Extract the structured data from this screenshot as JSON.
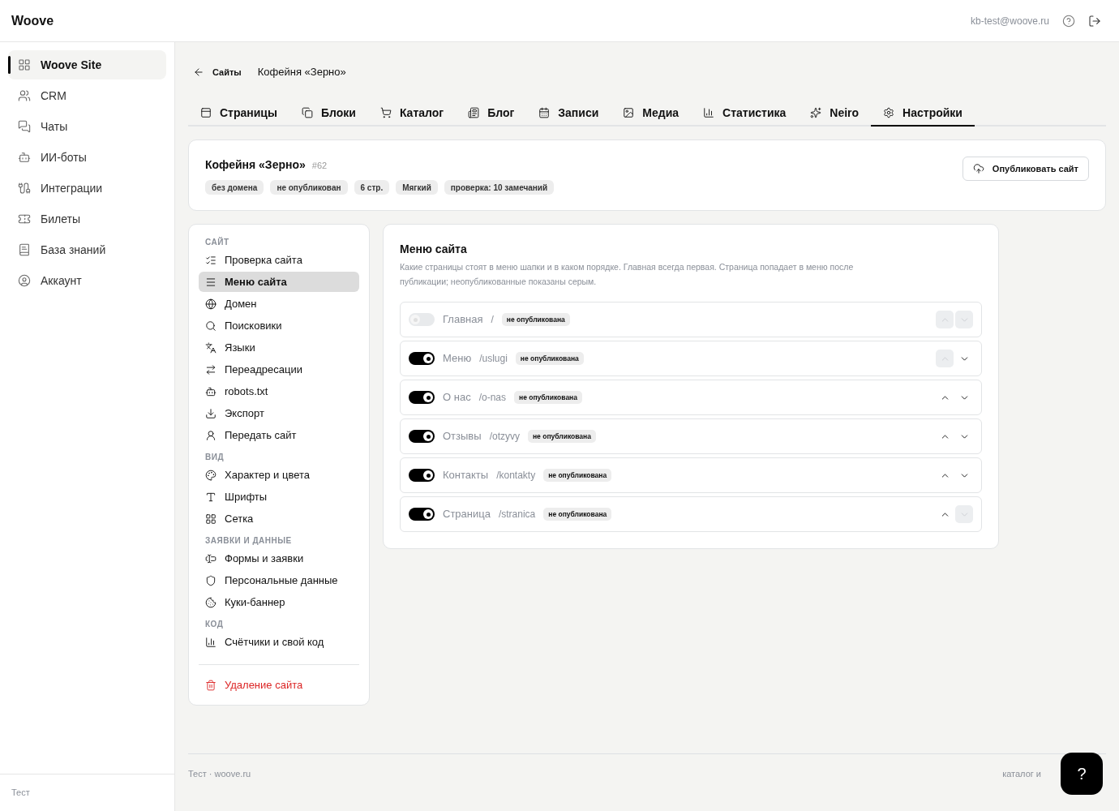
{
  "header": {
    "logo": "Woove",
    "email": "kb-test@woove.ru"
  },
  "sidebar": {
    "items": [
      {
        "label": "Woove Site",
        "selected": true
      },
      {
        "label": "CRM",
        "selected": false
      },
      {
        "label": "Чаты",
        "selected": false
      },
      {
        "label": "ИИ-боты",
        "selected": false
      },
      {
        "label": "Интеграции",
        "selected": false
      },
      {
        "label": "Билеты",
        "selected": false
      },
      {
        "label": "База знаний",
        "selected": false
      },
      {
        "label": "Аккаунт",
        "selected": false
      }
    ],
    "footer": "Тест"
  },
  "breadcrumb": {
    "back": "Сайты",
    "current": "Кофейня «Зерно»"
  },
  "tabs": [
    {
      "label": "Страницы",
      "selected": false
    },
    {
      "label": "Блоки",
      "selected": false
    },
    {
      "label": "Каталог",
      "selected": false
    },
    {
      "label": "Блог",
      "selected": false
    },
    {
      "label": "Записи",
      "selected": false
    },
    {
      "label": "Медиа",
      "selected": false
    },
    {
      "label": "Статистика",
      "selected": false
    },
    {
      "label": "Neiro",
      "selected": false
    },
    {
      "label": "Настройки",
      "selected": true
    }
  ],
  "site_card": {
    "title": "Кофейня «Зерно»",
    "id": "#62",
    "tags": [
      "без домена",
      "не опубликован",
      "6 стр.",
      "Мягкий",
      "проверка: 10 замечаний"
    ],
    "publish_button": "Опубликовать сайт"
  },
  "settings_nav": {
    "sections": [
      {
        "heading": "САЙТ",
        "items": [
          {
            "label": "Проверка сайта",
            "selected": false
          },
          {
            "label": "Меню сайта",
            "selected": true
          },
          {
            "label": "Домен",
            "selected": false
          },
          {
            "label": "Поисковики",
            "selected": false
          },
          {
            "label": "Языки",
            "selected": false
          },
          {
            "label": "Переадресации",
            "selected": false
          },
          {
            "label": "robots.txt",
            "selected": false
          },
          {
            "label": "Экспорт",
            "selected": false
          },
          {
            "label": "Передать сайт",
            "selected": false
          }
        ]
      },
      {
        "heading": "ВИД",
        "items": [
          {
            "label": "Характер и цвета",
            "selected": false
          },
          {
            "label": "Шрифты",
            "selected": false
          },
          {
            "label": "Сетка",
            "selected": false
          }
        ]
      },
      {
        "heading": "ЗАЯВКИ И ДАННЫЕ",
        "items": [
          {
            "label": "Формы и заявки",
            "selected": false
          },
          {
            "label": "Персональные данные",
            "selected": false
          },
          {
            "label": "Куки-баннер",
            "selected": false
          }
        ]
      },
      {
        "heading": "КОД",
        "items": [
          {
            "label": "Счётчики и свой код",
            "selected": false
          }
        ]
      }
    ],
    "delete": "Удаление сайта"
  },
  "menu_panel": {
    "title": "Меню сайта",
    "description": "Какие страницы стоят в меню шапки и в каком порядке. Главная всегда первая. Страница попадает в меню после публикации; неопубликованные показаны серым.",
    "rows": [
      {
        "name": "Главная",
        "path": "/",
        "status": "не опубликована",
        "on": false,
        "disabled": true,
        "up_disabled": true,
        "down_disabled": true
      },
      {
        "name": "Меню",
        "path": "/uslugi",
        "status": "не опубликована",
        "on": true,
        "disabled": false,
        "up_disabled": true,
        "down_disabled": false
      },
      {
        "name": "О нас",
        "path": "/o-nas",
        "status": "не опубликована",
        "on": true,
        "disabled": false,
        "up_disabled": false,
        "down_disabled": false
      },
      {
        "name": "Отзывы",
        "path": "/otzyvy",
        "status": "не опубликована",
        "on": true,
        "disabled": false,
        "up_disabled": false,
        "down_disabled": false
      },
      {
        "name": "Контакты",
        "path": "/kontakty",
        "status": "не опубликована",
        "on": true,
        "disabled": false,
        "up_disabled": false,
        "down_disabled": false
      },
      {
        "name": "Страница",
        "path": "/stranica",
        "status": "не опубликована",
        "on": true,
        "disabled": false,
        "up_disabled": false,
        "down_disabled": true
      }
    ]
  },
  "footer": {
    "left": "Тест · woove.ru",
    "right": "каталог и"
  },
  "help_button": "?"
}
